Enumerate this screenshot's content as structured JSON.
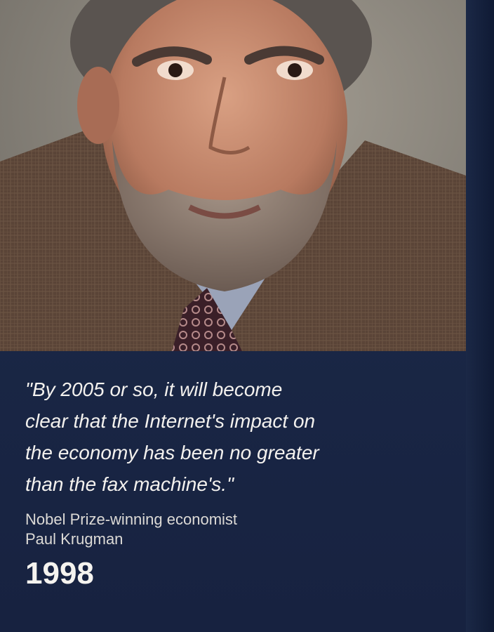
{
  "quote": {
    "text": "\"By 2005 or so, it will become\nclear that the Internet's impact on\nthe economy has been no greater\nthan the fax machine's.\""
  },
  "attribution": {
    "line1": "Nobel Prize-winning economist",
    "line2": "Paul Krugman"
  },
  "year": "1998",
  "colors": {
    "background": "#1c2a47",
    "text": "#f3f1ee"
  }
}
